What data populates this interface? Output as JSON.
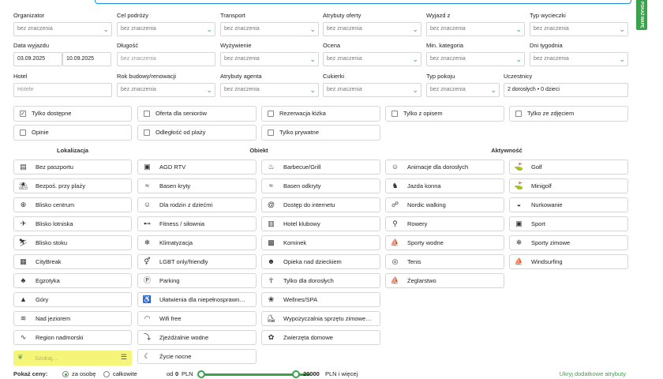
{
  "side_tab": "POKAŻ MAPĘ",
  "row1": [
    {
      "label": "Organizator",
      "value": "bez znaczenia"
    },
    {
      "label": "Cel podróży",
      "value": "bez znaczenia"
    },
    {
      "label": "Transport",
      "value": "bez znaczenia"
    },
    {
      "label": "Atrybuty oferty",
      "value": "bez znaczenia"
    },
    {
      "label": "Wyjazd z",
      "value": "bez znaczenia"
    },
    {
      "label": "Typ wycieczki",
      "value": "bez znaczenia"
    }
  ],
  "row2": {
    "date_label": "Data wyjazdu",
    "date_from": "03.09.2025",
    "date_to": "10.09.2025",
    "fields": [
      {
        "label": "Długość",
        "value": "bez znaczenia"
      },
      {
        "label": "Wyżywienie",
        "value": "bez znaczenia"
      },
      {
        "label": "Ocena",
        "value": "bez znaczenia"
      },
      {
        "label": "Min. kategoria",
        "value": "bez znaczenia"
      },
      {
        "label": "Dni tygodnia",
        "value": "bez znaczenia"
      }
    ]
  },
  "row3": {
    "hotel_label": "Hotel",
    "hotel_placeholder": "Hotele",
    "fields": [
      {
        "label": "Rok budowy/renowacji",
        "value": "bez znaczenia"
      },
      {
        "label": "Atrybuty agenta",
        "value": "bez znaczenia"
      },
      {
        "label": "Cukierki",
        "value": "bez znaczenia"
      },
      {
        "label": "Typ pokoju",
        "value": "bez znaczenia"
      }
    ],
    "participants_label": "Uczestnicy",
    "participants_value": "2 dorosłych • 0 dzieci"
  },
  "checkboxes": [
    {
      "label": "Tylko dostępne",
      "checked": true
    },
    {
      "label": "Oferta dla seniorów",
      "checked": false
    },
    {
      "label": "Rezerwacja łóżka",
      "checked": false
    },
    {
      "label": "Tylko z opisem",
      "checked": false
    },
    {
      "label": "Tylko ze zdjęciem",
      "checked": false
    },
    {
      "label": "Opinie",
      "checked": false
    },
    {
      "label": "Odległość od plaży",
      "checked": false
    },
    {
      "label": "Tylko prywatne",
      "checked": false
    }
  ],
  "headings": {
    "lokalizacja": "Lokalizacja",
    "obiekt": "Obiekt",
    "aktywnosc": "Aktywność"
  },
  "lokalizacja": [
    {
      "label": "Bez paszportu",
      "icon": "passport-icon",
      "glyph": "▤"
    },
    {
      "label": "Bezpoś. przy plaży",
      "icon": "beach-icon",
      "glyph": "⛱"
    },
    {
      "label": "Blisko centrum",
      "icon": "city-center-icon",
      "glyph": "⊕"
    },
    {
      "label": "Blisko lotniska",
      "icon": "airport-icon",
      "glyph": "✈"
    },
    {
      "label": "Blisko stoku",
      "icon": "ski-lift-icon",
      "glyph": "⛷"
    },
    {
      "label": "CityBreak",
      "icon": "citybreak-icon",
      "glyph": "▦"
    },
    {
      "label": "Egzotyka",
      "icon": "palm-icon",
      "glyph": "♣"
    },
    {
      "label": "Góry",
      "icon": "mountain-icon",
      "glyph": "▲"
    },
    {
      "label": "Nad jeziorem",
      "icon": "lake-icon",
      "glyph": "≋"
    },
    {
      "label": "Region nadmorski",
      "icon": "sea-icon",
      "glyph": "∿"
    }
  ],
  "obiekt_col1": [
    {
      "label": "AGD RTV",
      "icon": "tv-icon",
      "glyph": "▣"
    },
    {
      "label": "Basen kryty",
      "icon": "pool-indoor-icon",
      "glyph": "≈"
    },
    {
      "label": "Dla rodzin z dziećmi",
      "icon": "family-icon",
      "glyph": "☺"
    },
    {
      "label": "Fitness / siłownia",
      "icon": "dumbbell-icon",
      "glyph": "⊷"
    },
    {
      "label": "Klimatyzacja",
      "icon": "air-conditioning-icon",
      "glyph": "❄"
    },
    {
      "label": "LGBT only/friendly",
      "icon": "lgbt-icon",
      "glyph": "⚥"
    },
    {
      "label": "Parking",
      "icon": "parking-icon",
      "glyph": "Ⓟ"
    },
    {
      "label": "Ułatwienia dla niepełnosprawn…",
      "icon": "wheelchair-icon",
      "glyph": "♿"
    },
    {
      "label": "Wifi free",
      "icon": "wifi-icon",
      "glyph": "◠"
    },
    {
      "label": "Zjeżdżalnie wodne",
      "icon": "waterslide-icon",
      "glyph": "⤵"
    },
    {
      "label": "Życie nocne",
      "icon": "nightlife-icon",
      "glyph": "☾"
    }
  ],
  "obiekt_col2": [
    {
      "label": "Barbecue/Grill",
      "icon": "grill-icon",
      "glyph": "♨"
    },
    {
      "label": "Basen odkryty",
      "icon": "pool-outdoor-icon",
      "glyph": "≈"
    },
    {
      "label": "Dostęp do internetu",
      "icon": "at-icon",
      "glyph": "@"
    },
    {
      "label": "Hotel klubowy",
      "icon": "club-hotel-icon",
      "glyph": "▥"
    },
    {
      "label": "Kominek",
      "icon": "fireplace-icon",
      "glyph": "▩"
    },
    {
      "label": "Opieka nad dzieckiem",
      "icon": "childcare-icon",
      "glyph": "☻"
    },
    {
      "label": "Tylko dla dorosłych",
      "icon": "adults-icon",
      "glyph": "☥"
    },
    {
      "label": "Wellnes/SPA",
      "icon": "spa-icon",
      "glyph": "❀"
    },
    {
      "label": "Wypożyczalnia sprzętu zimowe…",
      "icon": "ski-rental-icon",
      "glyph": "⛸"
    },
    {
      "label": "Zwierzęta domowe",
      "icon": "pets-icon",
      "glyph": "✿"
    }
  ],
  "aktywnosc_col1": [
    {
      "label": "Animacje dla dorosłych",
      "icon": "animation-icon",
      "glyph": "☺"
    },
    {
      "label": "Jazda konna",
      "icon": "horse-icon",
      "glyph": "♞"
    },
    {
      "label": "Nordic walking",
      "icon": "walking-icon",
      "glyph": "☍"
    },
    {
      "label": "Rowery",
      "icon": "bicycle-icon",
      "glyph": "⚲"
    },
    {
      "label": "Sporty wodne",
      "icon": "water-sports-icon",
      "glyph": "⛵"
    },
    {
      "label": "Tenis",
      "icon": "tennis-icon",
      "glyph": "◎"
    },
    {
      "label": "Żeglarstwo",
      "icon": "sailing-icon",
      "glyph": "⛵"
    }
  ],
  "aktywnosc_col2": [
    {
      "label": "Golf",
      "icon": "golf-icon",
      "glyph": "⛳"
    },
    {
      "label": "Minigolf",
      "icon": "minigolf-icon",
      "glyph": "⛳"
    },
    {
      "label": "Nurkowanie",
      "icon": "diving-icon",
      "glyph": "◒"
    },
    {
      "label": "Sport",
      "icon": "sport-icon",
      "glyph": "▣"
    },
    {
      "label": "Sporty zimowe",
      "icon": "winter-sports-icon",
      "glyph": "❄"
    },
    {
      "label": "Windsurfing",
      "icon": "windsurfing-icon",
      "glyph": "⛵"
    }
  ],
  "search": {
    "placeholder": "Szukaj..."
  },
  "bottom": {
    "show_prices": "Pokaż ceny:",
    "per_person": "za osobę",
    "total": "całkowite",
    "from_prefix": "od",
    "from_value": "0",
    "currency": "PLN",
    "to_value": "20000",
    "to_suffix": "PLN i więcej",
    "hide_link": "Ukryj dodatkowe atrybuty"
  }
}
